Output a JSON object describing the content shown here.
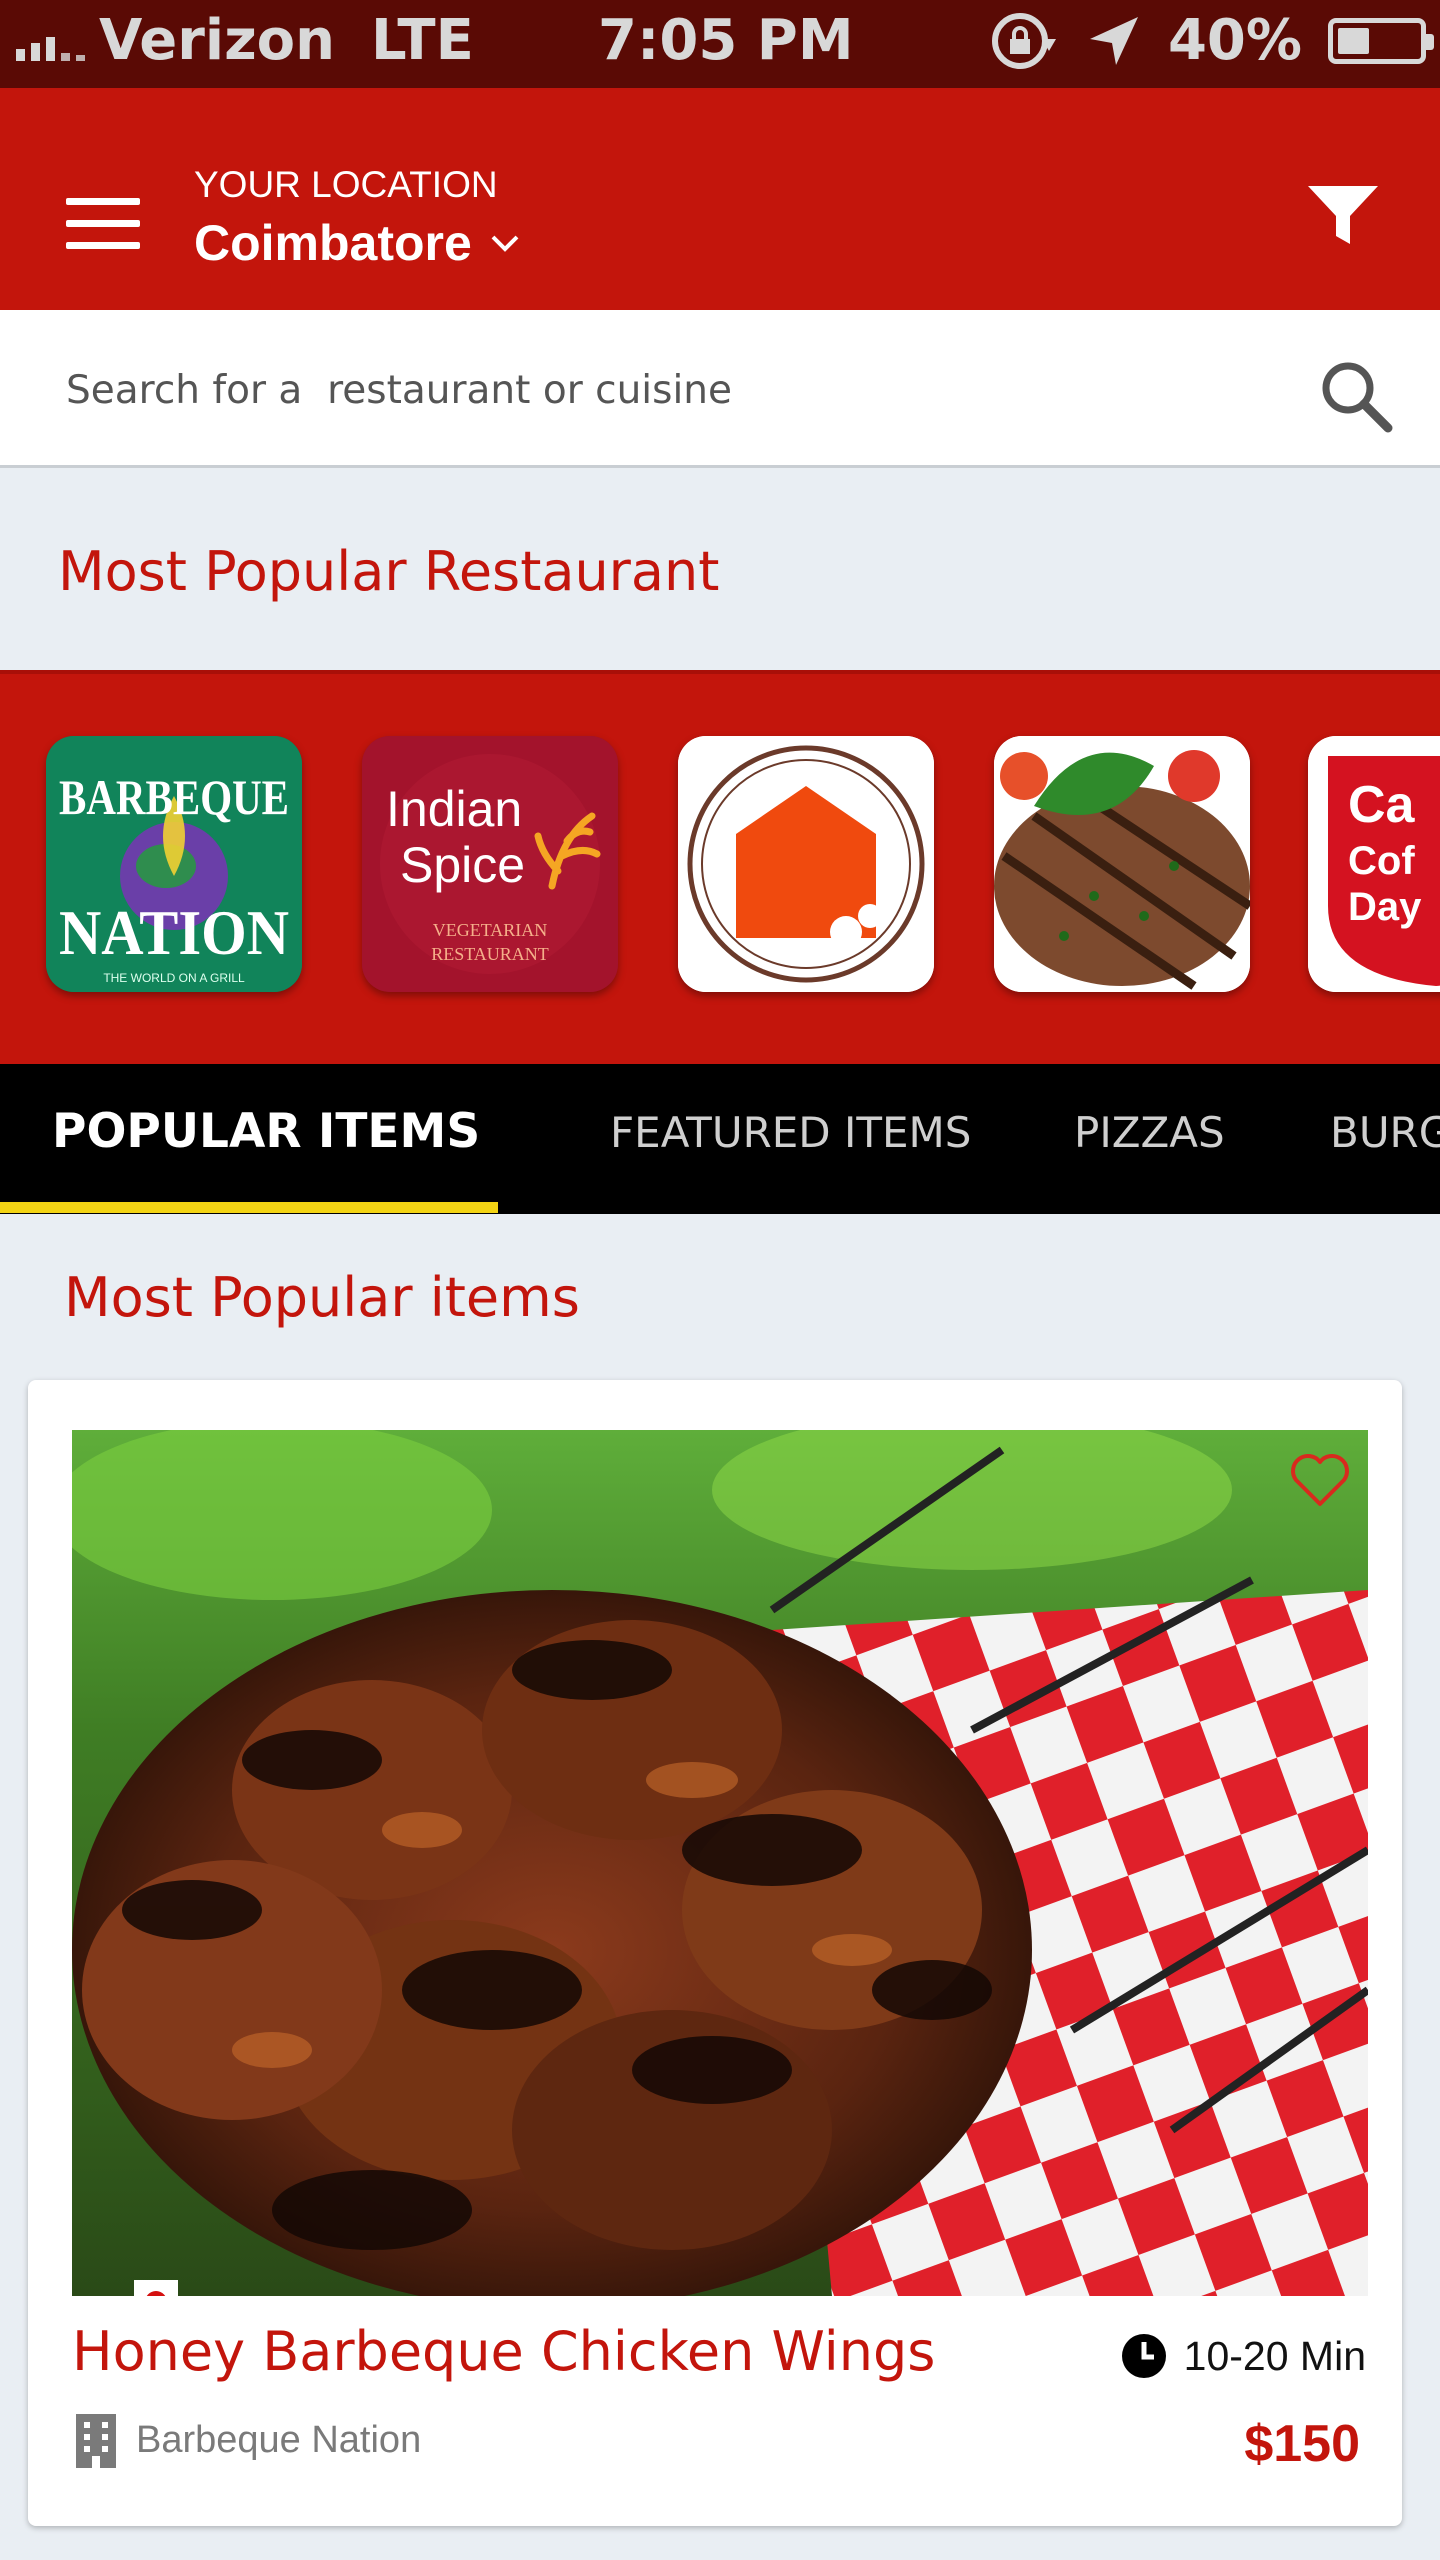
{
  "status_bar": {
    "carrier": "Verizon",
    "network": "LTE",
    "time": "7:05 PM",
    "battery": "40%",
    "battery_level": 0.4
  },
  "header": {
    "location_caption": "YOUR LOCATION",
    "location_value": "Coimbatore"
  },
  "search": {
    "placeholder": "Search for a  restaurant or cuisine"
  },
  "popular_restaurants": {
    "title": "Most Popular Restaurant",
    "logos": [
      {
        "line1": "BARBEQUE",
        "line2": "NATION",
        "tagline": "THE WORLD ON A GRILL"
      },
      {
        "line1": "Indian",
        "line2": "Spice",
        "tagline1": "VEGETARIAN",
        "tagline2": "RESTAURANT"
      },
      {},
      {},
      {
        "line1": "Ca",
        "line2": "Cof",
        "line3": "Day"
      }
    ]
  },
  "tabs": [
    {
      "label": "POPULAR ITEMS",
      "active": true
    },
    {
      "label": "FEATURED ITEMS",
      "active": false
    },
    {
      "label": "PIZZAS",
      "active": false
    },
    {
      "label": "BURG",
      "active": false
    }
  ],
  "items_section": {
    "title": "Most Popular items"
  },
  "item_card": {
    "name": "Honey Barbeque Chicken Wings",
    "delivery_time": "10-20 Min",
    "restaurant": "Barbeque Nation",
    "price": "$150"
  },
  "colors": {
    "brand_red": "#c3150c",
    "tab_indicator": "#f3d414",
    "status_bar": "#5a0a05"
  }
}
